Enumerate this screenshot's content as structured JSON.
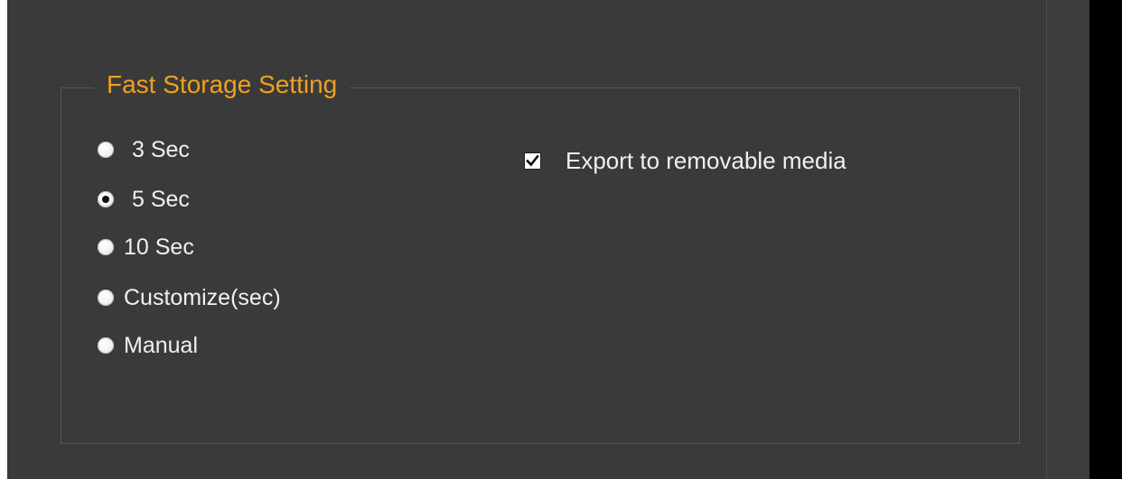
{
  "fast_storage": {
    "title": "Fast Storage Setting",
    "options": [
      {
        "label": "3 Sec",
        "selected": false
      },
      {
        "label": "5 Sec",
        "selected": true
      },
      {
        "label": "10 Sec",
        "selected": false
      },
      {
        "label": "Customize(sec)",
        "selected": false
      },
      {
        "label": "Manual",
        "selected": false
      }
    ],
    "export": {
      "label": "Export to removable media",
      "checked": true
    }
  },
  "colors": {
    "background": "#3a3a3a",
    "title_accent": "#f0a020",
    "text": "#f0f0f0"
  }
}
